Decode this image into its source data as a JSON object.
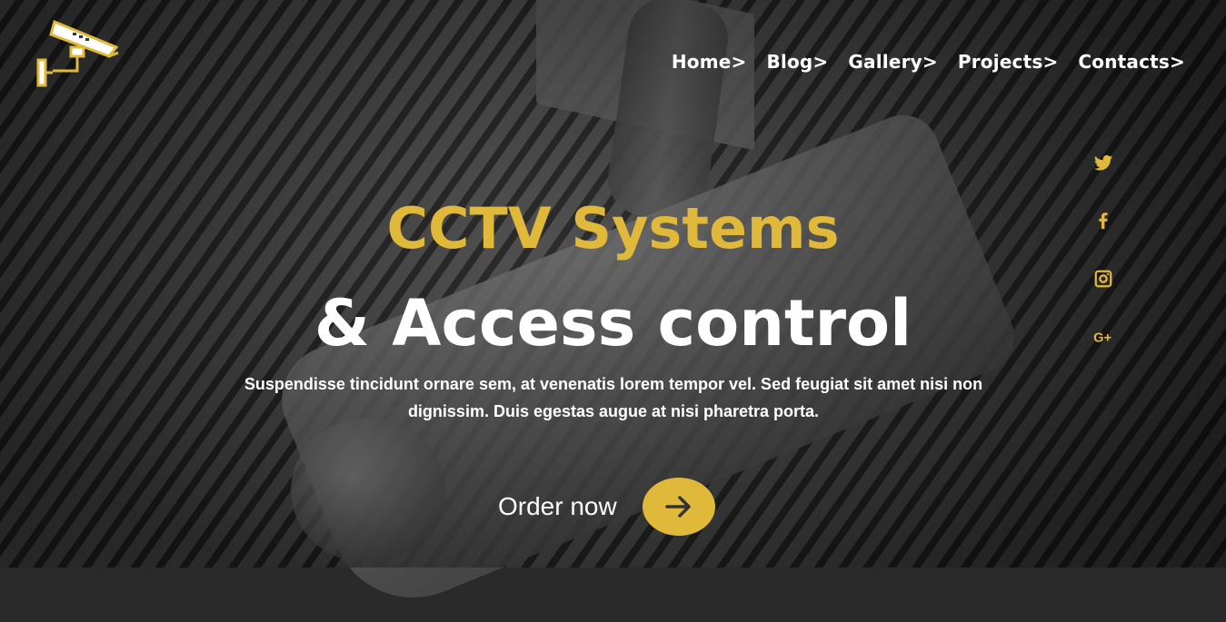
{
  "nav": {
    "items": [
      {
        "label": "Home>"
      },
      {
        "label": "Blog>"
      },
      {
        "label": "Gallery>"
      },
      {
        "label": "Projects>"
      },
      {
        "label": "Contacts>"
      }
    ]
  },
  "social": {
    "icons": [
      "twitter-icon",
      "facebook-icon",
      "instagram-icon",
      "google-plus-icon"
    ]
  },
  "hero": {
    "title": "CCTV Systems",
    "subtitle": "& Access control",
    "description": "Suspendisse tincidunt ornare sem, at venenatis lorem tempor vel. Sed feugiat sit amet nisi non dignissim. Duis egestas augue at nisi pharetra porta.",
    "cta_label": "Order now"
  },
  "colors": {
    "accent": "#e0b93a",
    "text": "#ffffff"
  }
}
